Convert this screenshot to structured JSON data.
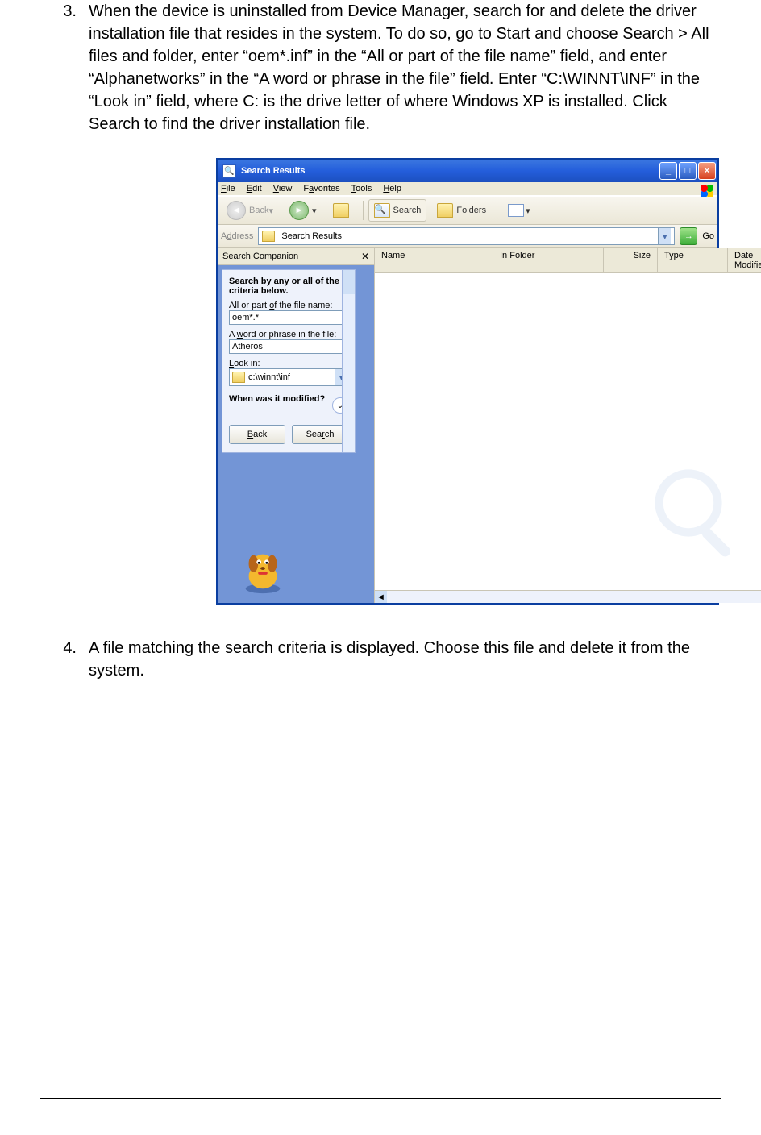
{
  "step3": {
    "num": "3.",
    "text": "When the device is uninstalled from Device Manager, search for and delete the driver installation file that resides in the system. To do so, go to Start and choose Search > All files and folder, enter “oem*.inf” in the “All or part of the file name” field, and enter “Alphanetworks” in the “A word or phrase in the file” field. Enter “C:\\WINNT\\INF” in the “Look in” field, where C: is the drive letter of where Windows XP is installed. Click Search to find the driver installation file."
  },
  "step4": {
    "num": "4.",
    "text": "A file matching the search criteria is displayed. Choose this file and delete it from the system."
  },
  "window": {
    "title": "Search Results",
    "menus": {
      "file": "File",
      "edit": "Edit",
      "view": "View",
      "favorites": "Favorites",
      "tools": "Tools",
      "help": "Help"
    },
    "toolbar": {
      "back": "Back",
      "search": "Search",
      "folders": "Folders"
    },
    "address": {
      "label": "Address",
      "value": "Search Results",
      "go": "Go"
    },
    "leftpane": {
      "title": "Search Companion",
      "heading": "Search by any or all of the criteria below.",
      "filename_label": "All or part of the file name:",
      "filename_value": "oem*.*",
      "phrase_label": "A word or phrase in the file:",
      "phrase_value": "Atheros",
      "lookin_label": "Look in:",
      "lookin_value": "c:\\winnt\\inf",
      "modified_label": "When was it modified?",
      "back": "Back",
      "search": "Search"
    },
    "columns": {
      "name": "Name",
      "infolder": "In Folder",
      "size": "Size",
      "type": "Type",
      "date": "Date Modified"
    }
  }
}
